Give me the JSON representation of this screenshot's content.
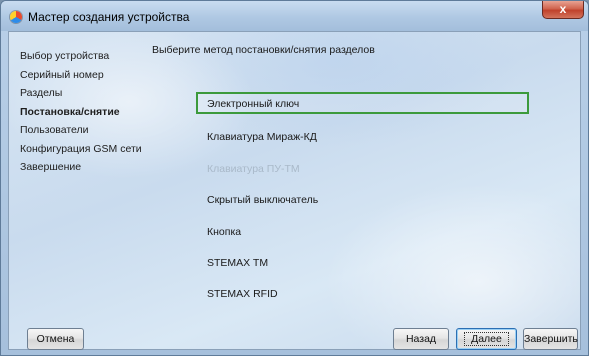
{
  "window": {
    "title": "Мастер создания устройства",
    "close_label": "x"
  },
  "steps": [
    {
      "label": "Выбор устройства",
      "active": false
    },
    {
      "label": "Серийный номер",
      "active": false
    },
    {
      "label": "Разделы",
      "active": false
    },
    {
      "label": "Постановка/снятие",
      "active": true
    },
    {
      "label": "Пользователи",
      "active": false
    },
    {
      "label": "Конфигурация GSM сети",
      "active": false
    },
    {
      "label": "Завершение",
      "active": false
    }
  ],
  "main": {
    "heading": "Выберите метод постановки/снятия разделов",
    "methods": [
      {
        "label": "Электронный ключ",
        "state": "selected"
      },
      {
        "label": "Клавиатура Мираж-КД",
        "state": "normal"
      },
      {
        "label": "Клавиатура ПУ-ТМ",
        "state": "disabled"
      },
      {
        "label": "Скрытый выключатель",
        "state": "normal"
      },
      {
        "label": "Кнопка",
        "state": "normal"
      },
      {
        "label": "STEMAX TM",
        "state": "normal"
      },
      {
        "label": "STEMAX RFID",
        "state": "normal"
      }
    ]
  },
  "buttons": {
    "cancel": "Отмена",
    "back": "Назад",
    "next": "Далее",
    "finish": "Завершить"
  },
  "colors": {
    "selection_border": "#3c9a3c",
    "disabled_text": "#a9b9c9"
  }
}
